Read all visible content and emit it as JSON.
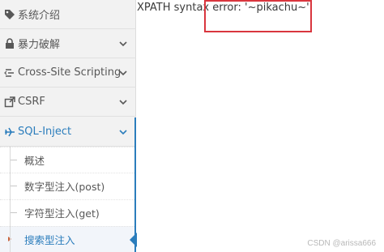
{
  "sidebar": {
    "items": [
      {
        "label": "系统介绍",
        "icon": "tag-icon"
      },
      {
        "label": "暴力破解",
        "icon": "lock-icon"
      },
      {
        "label": "Cross-Site Scripting",
        "icon": "xss-icon"
      },
      {
        "label": "CSRF",
        "icon": "external-link-icon"
      },
      {
        "label": "SQL-Inject",
        "icon": "plane-icon"
      }
    ],
    "subitems": [
      {
        "label": "概述"
      },
      {
        "label": "数字型注入(post)"
      },
      {
        "label": "字符型注入(get)"
      },
      {
        "label": "搜索型注入"
      }
    ]
  },
  "content": {
    "error_text": "XPATH syntax error: '~pikachu~'"
  },
  "watermark": "CSDN @arissa666",
  "colors": {
    "accent": "#2b7dbc",
    "highlight": "#d9363e"
  }
}
